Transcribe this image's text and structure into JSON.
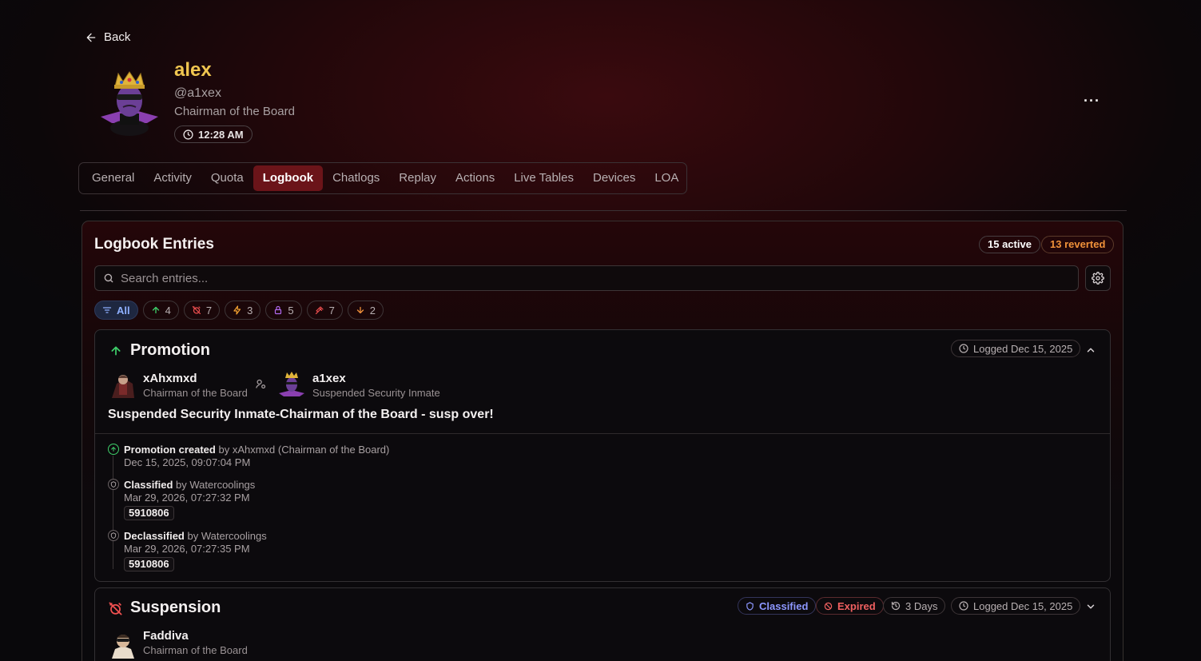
{
  "nav": {
    "back_label": "Back"
  },
  "profile": {
    "display_name": "alex",
    "username": "@a1xex",
    "rank": "Chairman of the Board",
    "local_time": "12:28 AM",
    "more_label": "···"
  },
  "tabs": [
    {
      "label": "General"
    },
    {
      "label": "Activity"
    },
    {
      "label": "Quota"
    },
    {
      "label": "Logbook",
      "active": true
    },
    {
      "label": "Chatlogs"
    },
    {
      "label": "Replay"
    },
    {
      "label": "Actions"
    },
    {
      "label": "Live Tables"
    },
    {
      "label": "Devices"
    },
    {
      "label": "LOA"
    }
  ],
  "logbook": {
    "title": "Logbook Entries",
    "active_count": "15 active",
    "reverted_count": "13 reverted",
    "search_placeholder": "Search entries...",
    "filters": [
      {
        "label": "All",
        "icon": "filter-icon",
        "color": "#8fb0ff"
      },
      {
        "label": "4",
        "icon": "arrow-up-icon",
        "color": "#3ecf6a"
      },
      {
        "label": "7",
        "icon": "alarm-off-icon",
        "color": "#f05050"
      },
      {
        "label": "3",
        "icon": "bolt-icon",
        "color": "#f0a030"
      },
      {
        "label": "5",
        "icon": "lock-icon",
        "color": "#b06af0"
      },
      {
        "label": "7",
        "icon": "gavel-icon",
        "color": "#f05050"
      },
      {
        "label": "2",
        "icon": "arrow-down-icon",
        "color": "#f0913a"
      }
    ]
  },
  "entries": [
    {
      "type": "Promotion",
      "logged": "Logged Dec 15, 2025",
      "issuer": {
        "name": "xAhxmxd",
        "rank": "Chairman of the Board"
      },
      "target": {
        "name": "a1xex",
        "rank": "Suspended Security Inmate"
      },
      "reason": "Suspended Security Inmate-Chairman of the Board - susp over!",
      "timeline": [
        {
          "action": "Promotion created",
          "by": "by xAhxmxd (Chairman of the Board)",
          "date": "Dec 15, 2025, 09:07:04 PM",
          "tag": ""
        },
        {
          "action": "Classified",
          "by": "by Watercoolings",
          "date": "Mar 29, 2026, 07:27:32 PM",
          "tag": "5910806"
        },
        {
          "action": "Declassified",
          "by": "by Watercoolings",
          "date": "Mar 29, 2026, 07:27:35 PM",
          "tag": "5910806"
        }
      ]
    },
    {
      "type": "Suspension",
      "classified": "Classified",
      "status": "Expired",
      "duration": "3 Days",
      "logged": "Logged Dec 15, 2025",
      "issuer": {
        "name": "Faddiva",
        "rank": "Chairman of the Board"
      }
    }
  ],
  "colors": {
    "accent": "#6b1419",
    "gold": "#f0c650",
    "promo_green": "#3ecf6a",
    "suspension_red": "#f05050"
  }
}
